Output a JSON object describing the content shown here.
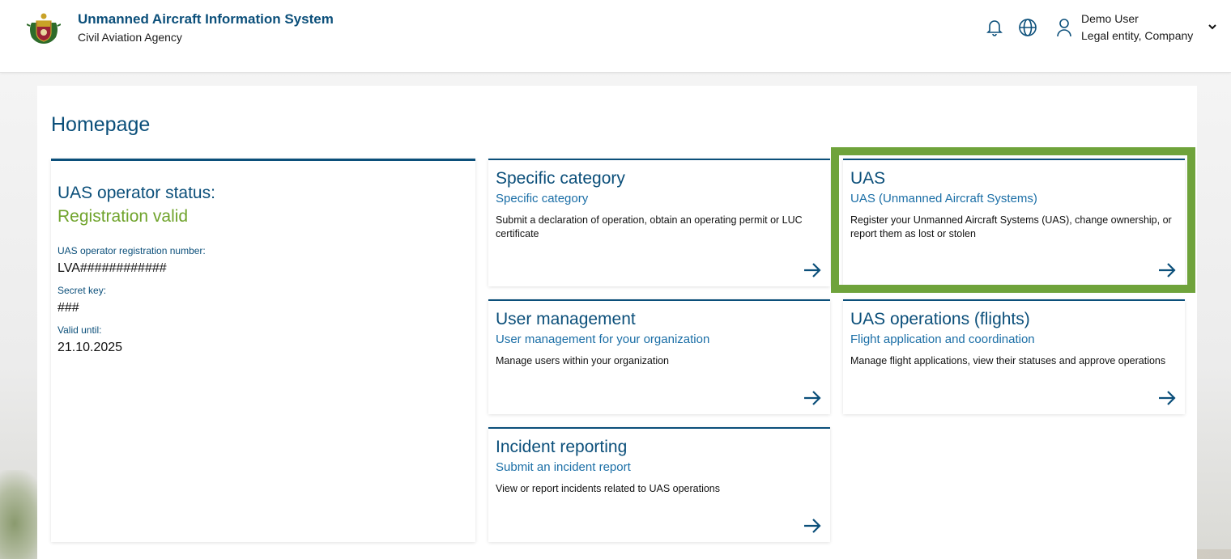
{
  "header": {
    "app_title": "Unmanned Aircraft Information System",
    "app_subtitle": "Civil Aviation Agency",
    "icons": [
      "bell-icon",
      "globe-icon",
      "user-icon",
      "chevron-down-icon"
    ],
    "user_name": "Demo User",
    "user_entity": "Legal entity, Company"
  },
  "page": {
    "title": "Homepage"
  },
  "status_card": {
    "title": "UAS operator status:",
    "status": "Registration valid",
    "reg_label": "UAS operator registration number:",
    "reg_value": "LVA############",
    "key_label": "Secret key:",
    "key_value": "###",
    "valid_label": "Valid until:",
    "valid_value": "21.10.2025"
  },
  "tiles": [
    {
      "title": "Specific category",
      "subtitle": "Specific category",
      "description": "Submit a declaration of operation, obtain an operating permit or LUC certificate"
    },
    {
      "title": "UAS",
      "subtitle": "UAS (Unmanned Aircraft Systems)",
      "description": "Register your Unmanned Aircraft Systems (UAS), change ownership, or report them as lost or stolen"
    },
    {
      "title": "User management",
      "subtitle": "User management for your organization",
      "description": "Manage users within your organization"
    },
    {
      "title": "UAS operations (flights)",
      "subtitle": "Flight application and coordination",
      "description": "Manage flight applications, view their statuses and approve operations"
    },
    {
      "title": "Incident reporting",
      "subtitle": "Submit an incident report",
      "description": "View or report incidents related to UAS operations"
    }
  ],
  "colors": {
    "primary": "#0b4f7a",
    "link": "#1a6ea6",
    "valid_status": "#6fa32b",
    "highlight_border": "#6fa33b"
  }
}
